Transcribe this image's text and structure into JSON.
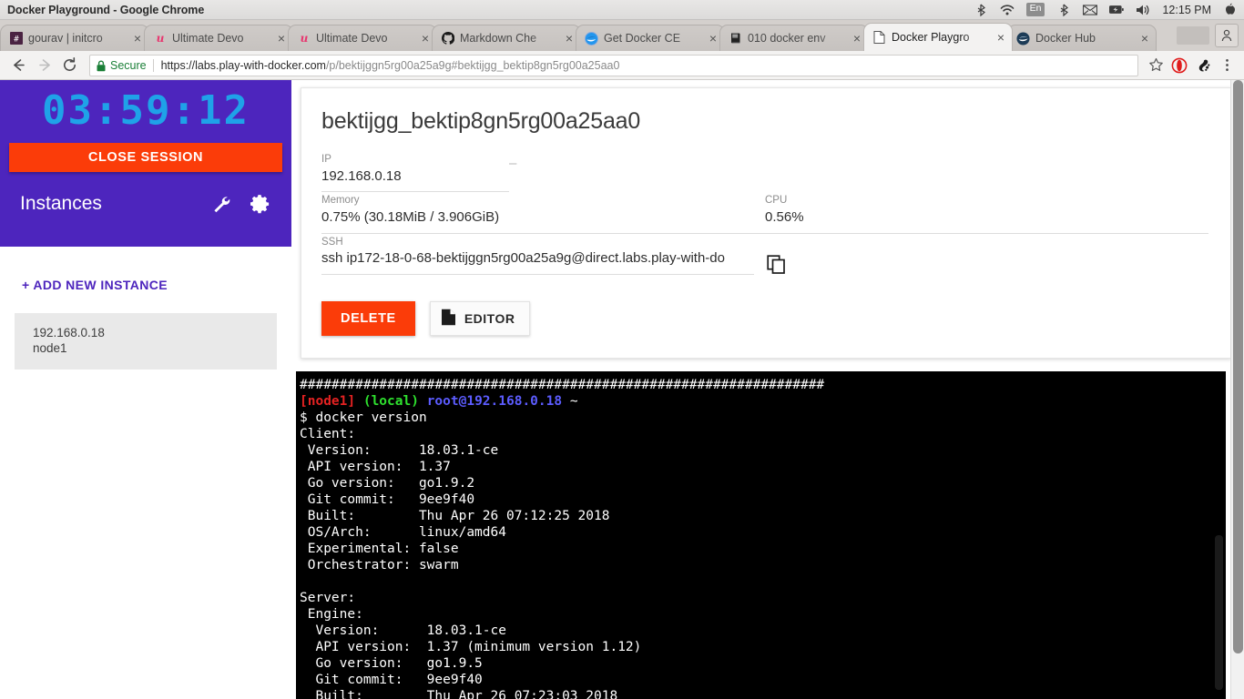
{
  "os": {
    "window_title": "Docker Playground - Google Chrome",
    "tray": {
      "bluetooth_icon": "bluetooth-icon",
      "wifi_icon": "wifi-icon",
      "language": "En",
      "bluetooth2_icon": "bluetooth-icon",
      "mail_icon": "mail-icon",
      "battery_icon": "battery-icon",
      "volume_icon": "volume-icon",
      "clock": "12:15 PM",
      "power_icon": "power-icon"
    }
  },
  "browser": {
    "tabs": [
      {
        "title": "gourav | initcro",
        "favicon": "hash-icon",
        "active": false
      },
      {
        "title": "Ultimate Devo",
        "favicon": "udemy-icon",
        "active": false
      },
      {
        "title": "Ultimate Devo",
        "favicon": "udemy-icon",
        "active": false
      },
      {
        "title": "Markdown Che",
        "favicon": "github-icon",
        "active": false
      },
      {
        "title": "Get Docker CE",
        "favicon": "docker-docs-icon",
        "active": false
      },
      {
        "title": "010 docker env",
        "favicon": "book-icon",
        "active": false
      },
      {
        "title": "Docker Playgro",
        "favicon": "page-icon",
        "active": true
      },
      {
        "title": "Docker Hub",
        "favicon": "docker-whale-icon",
        "active": false
      }
    ],
    "tab_close_label": "×",
    "toolbar": {
      "back_icon": "back-arrow-icon",
      "forward_icon": "forward-arrow-icon",
      "reload_icon": "reload-icon",
      "secure_label": "Secure",
      "url_host": "https://labs.play-with-docker.com",
      "url_path": "/p/bektijggn5rg00a25a9g#bektijgg_bektip8gn5rg00a25aa0",
      "bookmark_icon": "star-icon",
      "opera_icon": "opera-extension-icon",
      "gnome_icon": "gnome-foot-icon",
      "menu_icon": "kebab-menu-icon"
    }
  },
  "sidebar": {
    "timer": "03:59:12",
    "close_session_label": "CLOSE SESSION",
    "instances_heading": "Instances",
    "wrench_icon": "wrench-icon",
    "gear_icon": "gear-icon",
    "add_instance_label": "+ ADD NEW INSTANCE",
    "instances": [
      {
        "ip": "192.168.0.18",
        "name": "node1"
      }
    ]
  },
  "card": {
    "title": "bektijgg_bektip8gn5rg00a25aa0",
    "fields": {
      "ip_label": "IP",
      "ip_value": "192.168.0.18",
      "blank_label": "",
      "blank_value": "–",
      "memory_label": "Memory",
      "memory_value": "0.75% (30.18MiB / 3.906GiB)",
      "cpu_label": "CPU",
      "cpu_value": "0.56%",
      "ssh_label": "SSH",
      "ssh_value": "ssh ip172-18-0-68-bektijggn5rg00a25a9g@direct.labs.play-with-do"
    },
    "copy_icon": "copy-icon",
    "delete_label": "DELETE",
    "editor_label": "EDITOR",
    "editor_icon": "file-icon"
  },
  "terminal": {
    "lines": [
      {
        "segments": [
          {
            "t": "##################################################################",
            "c": "c-white"
          }
        ]
      },
      {
        "segments": [
          {
            "t": "[node1]",
            "c": "c-red"
          },
          {
            "t": " ",
            "c": "c-white"
          },
          {
            "t": "(local)",
            "c": "c-green"
          },
          {
            "t": " ",
            "c": "c-white"
          },
          {
            "t": "root@192.168.0.18",
            "c": "c-blue"
          },
          {
            "t": " ~",
            "c": "c-white"
          }
        ]
      },
      {
        "segments": [
          {
            "t": "$ docker version",
            "c": "c-white"
          }
        ]
      },
      {
        "segments": [
          {
            "t": "Client:",
            "c": "c-white"
          }
        ]
      },
      {
        "segments": [
          {
            "t": " Version:      18.03.1-ce",
            "c": "c-white"
          }
        ]
      },
      {
        "segments": [
          {
            "t": " API version:  1.37",
            "c": "c-white"
          }
        ]
      },
      {
        "segments": [
          {
            "t": " Go version:   go1.9.2",
            "c": "c-white"
          }
        ]
      },
      {
        "segments": [
          {
            "t": " Git commit:   9ee9f40",
            "c": "c-white"
          }
        ]
      },
      {
        "segments": [
          {
            "t": " Built:        Thu Apr 26 07:12:25 2018",
            "c": "c-white"
          }
        ]
      },
      {
        "segments": [
          {
            "t": " OS/Arch:      linux/amd64",
            "c": "c-white"
          }
        ]
      },
      {
        "segments": [
          {
            "t": " Experimental: false",
            "c": "c-white"
          }
        ]
      },
      {
        "segments": [
          {
            "t": " Orchestrator: swarm",
            "c": "c-white"
          }
        ]
      },
      {
        "segments": [
          {
            "t": "",
            "c": "c-white"
          }
        ]
      },
      {
        "segments": [
          {
            "t": "Server:",
            "c": "c-white"
          }
        ]
      },
      {
        "segments": [
          {
            "t": " Engine:",
            "c": "c-white"
          }
        ]
      },
      {
        "segments": [
          {
            "t": "  Version:      18.03.1-ce",
            "c": "c-white"
          }
        ]
      },
      {
        "segments": [
          {
            "t": "  API version:  1.37 (minimum version 1.12)",
            "c": "c-white"
          }
        ]
      },
      {
        "segments": [
          {
            "t": "  Go version:   go1.9.5",
            "c": "c-white"
          }
        ]
      },
      {
        "segments": [
          {
            "t": "  Git commit:   9ee9f40",
            "c": "c-white"
          }
        ]
      },
      {
        "segments": [
          {
            "t": "  Built:        Thu Apr 26 07:23:03 2018",
            "c": "c-white"
          }
        ]
      }
    ]
  },
  "colors": {
    "brand_purple": "#4d25bd",
    "accent_orange": "#fb3c09",
    "timer_cyan": "#1fa2e8",
    "terminal_bg": "#000000",
    "secure_green": "#1a7f37"
  }
}
